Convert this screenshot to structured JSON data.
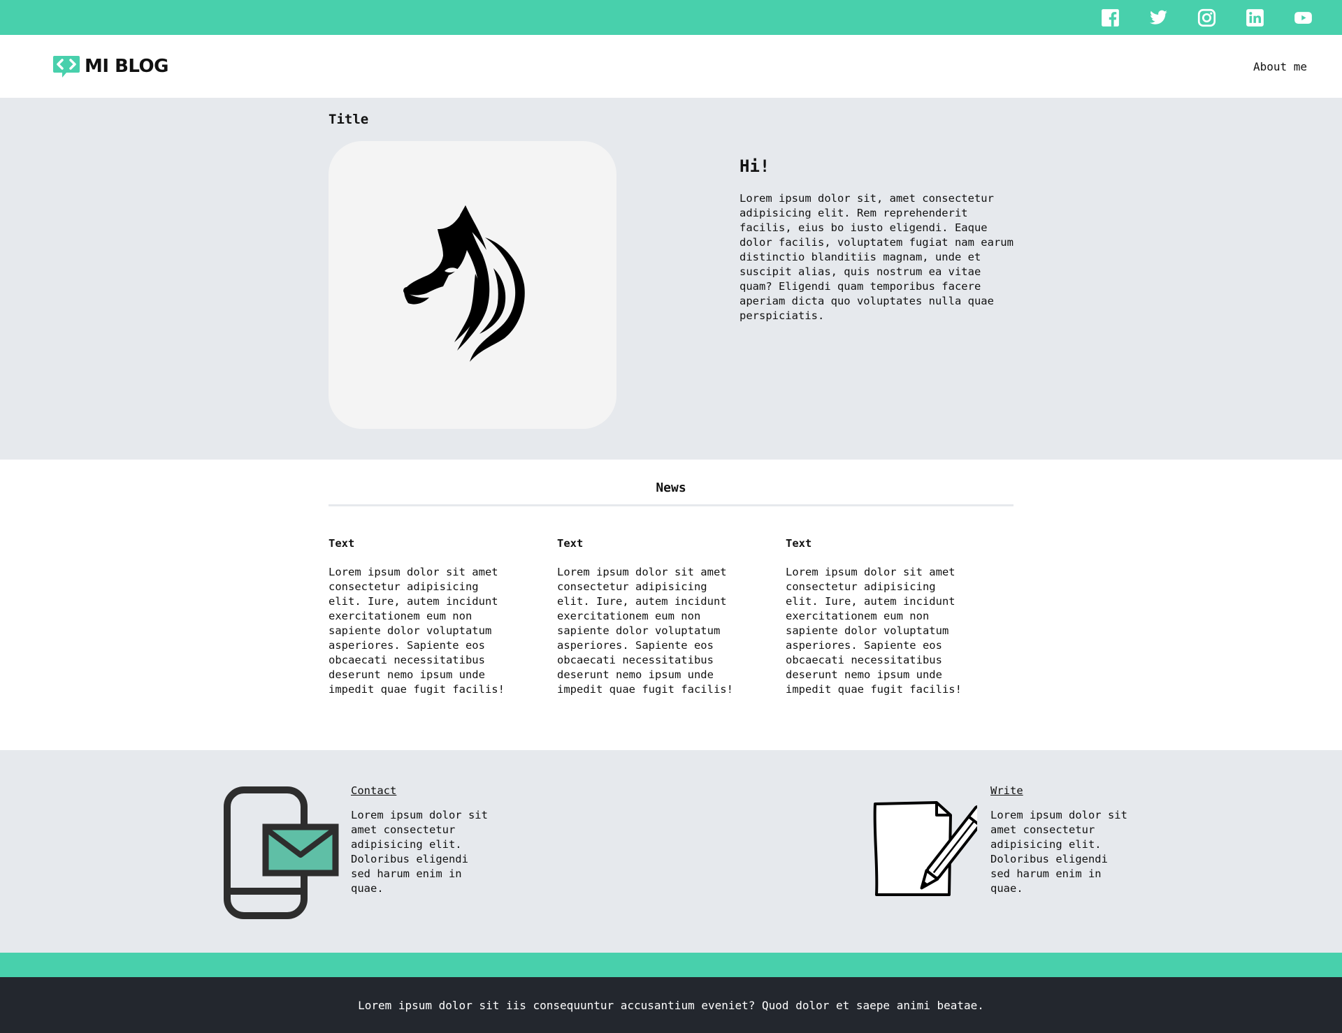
{
  "colors": {
    "accent": "#48d0ac",
    "light_bg": "#e6e9ed",
    "footer_bg": "#23272e"
  },
  "topbar": {
    "social_icons": [
      "facebook-icon",
      "twitter-icon",
      "instagram-icon",
      "linkedin-icon",
      "youtube-icon"
    ]
  },
  "nav": {
    "logo_text": "MI BLOG",
    "about_link": "About me"
  },
  "hero": {
    "title": "Title",
    "heading": "Hi!",
    "body": "Lorem ipsum dolor sit, amet consectetur adipisicing elit. Rem reprehenderit facilis, eius bo iusto eligendi. Eaque dolor facilis, voluptatem fugiat nam earum distinctio blanditiis magnam, unde et suscipit alias, quis nostrum ea vitae quam? Eligendi quam temporibus facere aperiam dicta quo voluptates nulla quae perspiciatis."
  },
  "news": {
    "title": "News",
    "items": [
      {
        "title": "Text",
        "body": "Lorem ipsum dolor sit amet consectetur adipisicing elit. Iure, autem incidunt exercitationem eum non sapiente dolor voluptatum asperiores. Sapiente eos obcaecati necessitatibus deserunt nemo ipsum unde impedit quae fugit facilis!"
      },
      {
        "title": "Text",
        "body": "Lorem ipsum dolor sit amet consectetur adipisicing elit. Iure, autem incidunt exercitationem eum non sapiente dolor voluptatum asperiores. Sapiente eos obcaecati necessitatibus deserunt nemo ipsum unde impedit quae fugit facilis!"
      },
      {
        "title": "Text",
        "body": "Lorem ipsum dolor sit amet consectetur adipisicing elit. Iure, autem incidunt exercitationem eum non sapiente dolor voluptatum asperiores. Sapiente eos obcaecati necessitatibus deserunt nemo ipsum unde impedit quae fugit facilis!"
      }
    ]
  },
  "contact": {
    "contact_link": "Contact",
    "contact_body": "Lorem ipsum dolor sit amet consectetur adipisicing elit. Doloribus eligendi sed harum enim in quae.",
    "write_link": "Write",
    "write_body": "Lorem ipsum dolor sit amet consectetur adipisicing elit. Doloribus eligendi sed harum enim in quae."
  },
  "footer": {
    "text": "Lorem ipsum dolor sit iis consequuntur accusantium eveniet? Quod dolor et saepe animi beatae."
  }
}
